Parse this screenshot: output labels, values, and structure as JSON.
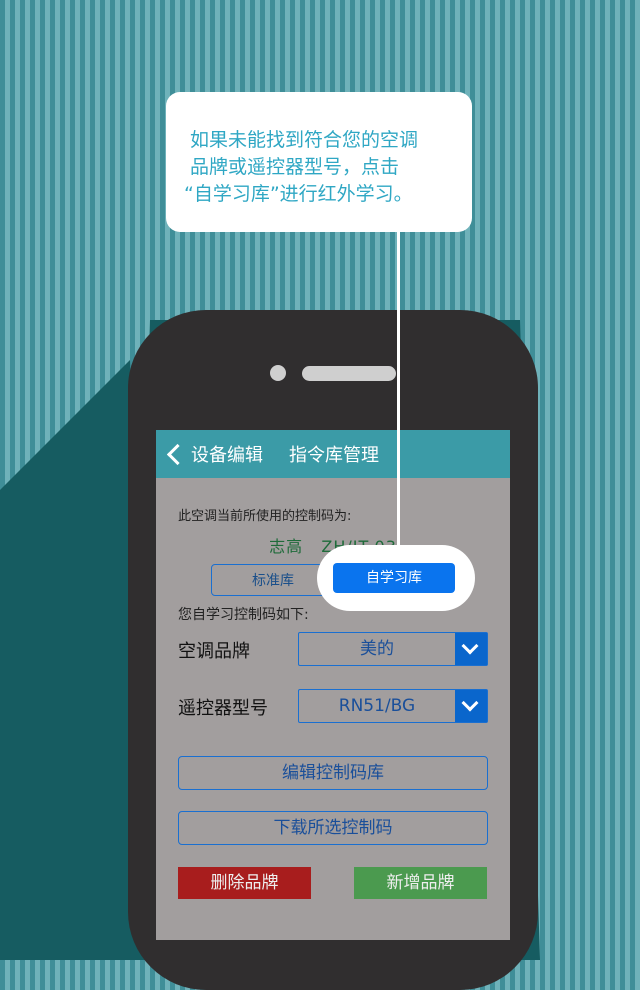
{
  "callout": {
    "lines": [
      "如果未能找到符合您的空调",
      "品牌或遥控器型号，点击",
      "“自学习库”进行红外学习。"
    ]
  },
  "nav": {
    "back_label": "设备编辑",
    "title": "指令库管理"
  },
  "info_text": "此空调当前所使用的控制码为:",
  "current_code": {
    "brand": "志高",
    "model": "ZH/JT-03"
  },
  "segment": {
    "standard": "标准库",
    "self_learn": "自学习库",
    "selected": "自学习库"
  },
  "self_learn_label": "您自学习控制码如下:",
  "brand_row": {
    "label": "空调品牌",
    "value": "美的"
  },
  "model_row": {
    "label": "遥控器型号",
    "value": "RN51/BG"
  },
  "buttons": {
    "edit": "编辑控制码库",
    "download": "下载所选控制码",
    "delete": "删除品牌",
    "add": "新增品牌"
  },
  "colors": {
    "navbar": "#3b9ba7",
    "accent": "#0a74ee",
    "delete": "#a81d1d",
    "add": "#4b9a4f",
    "callout_text": "#2fa7c4"
  }
}
